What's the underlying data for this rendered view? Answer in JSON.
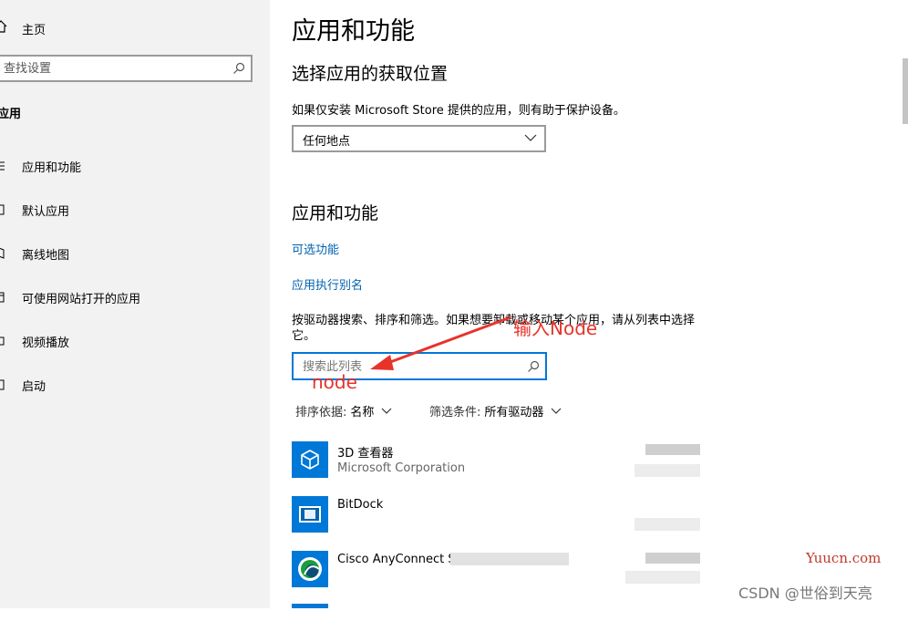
{
  "sidebar": {
    "home_label": "主页",
    "search_placeholder": "查找设置",
    "section_title": "应用",
    "items": [
      {
        "label": "应用和功能",
        "icon": "apps-list-icon"
      },
      {
        "label": "默认应用",
        "icon": "default-apps-icon"
      },
      {
        "label": "离线地图",
        "icon": "offline-maps-icon"
      },
      {
        "label": "可使用网站打开的应用",
        "icon": "apps-for-websites-icon"
      },
      {
        "label": "视频播放",
        "icon": "video-playback-icon"
      },
      {
        "label": "启动",
        "icon": "startup-icon"
      }
    ]
  },
  "main": {
    "title": "应用和功能",
    "install_heading": "选择应用的获取位置",
    "install_desc": "如果仅安装 Microsoft Store 提供的应用，则有助于保护设备。",
    "install_select_value": "任何地点",
    "apps_heading": "应用和功能",
    "link_optional": "可选功能",
    "link_alias": "应用执行别名",
    "search_hint": "按驱动器搜索、排序和筛选。如果想要卸载或移动某个应用，请从列表中选择它。",
    "list_search_placeholder": "搜索此列表",
    "sort_label": "排序依据:",
    "sort_value": "名称",
    "filter_label": "筛选条件:",
    "filter_value": "所有驱动器",
    "apps": [
      {
        "name": "3D 查看器",
        "publisher": "Microsoft Corporation"
      },
      {
        "name": "BitDock",
        "publisher": ""
      },
      {
        "name": "Cisco AnyConnect S",
        "publisher": ""
      }
    ]
  },
  "annotations": {
    "arrow_text": "输入Node",
    "typed_text": "node",
    "color": "#e8332a"
  },
  "watermarks": {
    "site": "Yuucn.com",
    "csdn": "CSDN @世俗到天亮"
  },
  "colors": {
    "accent": "#0078d7",
    "link": "#0063b1",
    "tile": "#0078d7"
  }
}
